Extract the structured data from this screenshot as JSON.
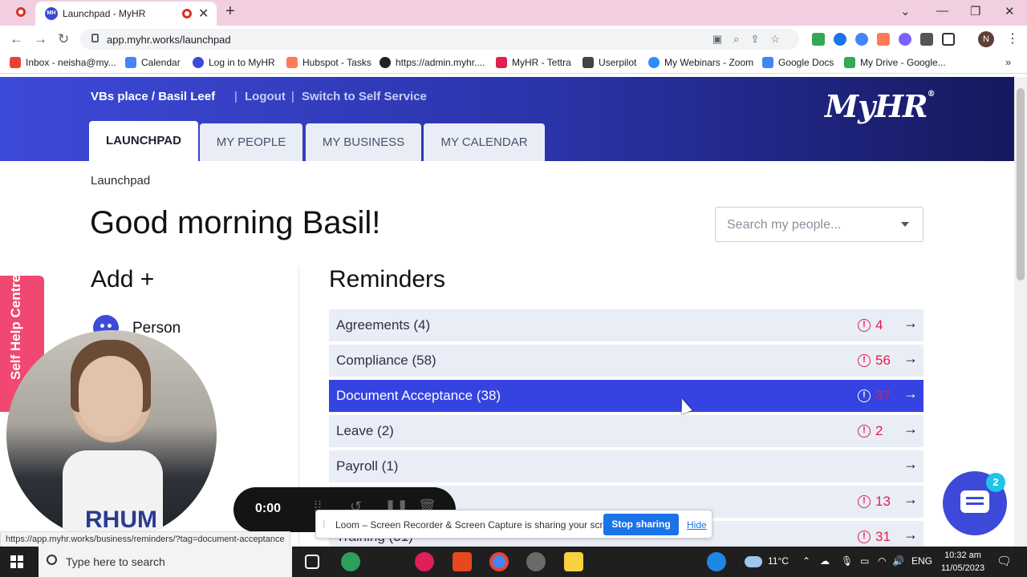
{
  "browser": {
    "tab_title": "Launchpad - MyHR",
    "tab_favicon_text": "MH",
    "url": "app.myhr.works/launchpad",
    "profile_initial": "N",
    "bookmarks": [
      {
        "label": "Inbox - neisha@my...",
        "color": "#ea4335"
      },
      {
        "label": "Calendar",
        "color": "#4285f4"
      },
      {
        "label": "Log in to MyHR",
        "color": "#3d4ad9"
      },
      {
        "label": "Hubspot - Tasks",
        "color": "#ff7a59"
      },
      {
        "label": "https://admin.myhr....",
        "color": "#222222"
      },
      {
        "label": "MyHR - Tettra",
        "color": "#e0204d"
      },
      {
        "label": "Userpilot",
        "color": "#444444"
      },
      {
        "label": "My Webinars - Zoom",
        "color": "#2d8cff"
      },
      {
        "label": "Google Docs",
        "color": "#4285f4"
      },
      {
        "label": "My Drive - Google...",
        "color": "#34a853"
      }
    ]
  },
  "header": {
    "user": "VBs place / Basil Leef",
    "logout": "Logout",
    "switch": "Switch to Self Service",
    "logo": "MyHR",
    "logo_mark": "®",
    "tabs": [
      "LAUNCHPAD",
      "MY PEOPLE",
      "MY BUSINESS",
      "MY CALENDAR"
    ],
    "active_tab": "LAUNCHPAD"
  },
  "main": {
    "breadcrumb": "Launchpad",
    "greeting": "Good morning Basil!",
    "search_placeholder": "Search my people...",
    "add_title": "Add +",
    "add_items": [
      "Person"
    ],
    "reminders_title": "Reminders",
    "reminders": [
      {
        "label": "Agreements (4)",
        "alert": "4",
        "highlight": false
      },
      {
        "label": "Compliance (58)",
        "alert": "56",
        "highlight": false
      },
      {
        "label": "Document Acceptance (38)",
        "alert": "37",
        "highlight": true
      },
      {
        "label": "Leave (2)",
        "alert": "2",
        "highlight": false
      },
      {
        "label": "Payroll (1)",
        "alert": "",
        "highlight": false
      },
      {
        "label": "",
        "alert": "13",
        "highlight": false
      },
      {
        "label": "Training (31)",
        "alert": "31",
        "highlight": false
      }
    ]
  },
  "overlays": {
    "help_centre": "Self Help Centre",
    "loom_timer": "0:00",
    "share_text": "Loom – Screen Recorder & Screen Capture is sharing your screen.",
    "stop_sharing": "Stop sharing",
    "hide": "Hide",
    "chat_badge": "2",
    "status_url": "https://app.myhr.works/business/reminders/?tag=document-acceptance",
    "webcam_shirt_text": "RHUM"
  },
  "taskbar": {
    "search_placeholder": "Type here to search",
    "temperature": "11°C",
    "language": "ENG",
    "time": "10:32 am",
    "date": "11/05/2023"
  },
  "colors": {
    "brand": "#3d4ad9",
    "alert": "#e0204d",
    "highlight_row": "#3543e0"
  }
}
